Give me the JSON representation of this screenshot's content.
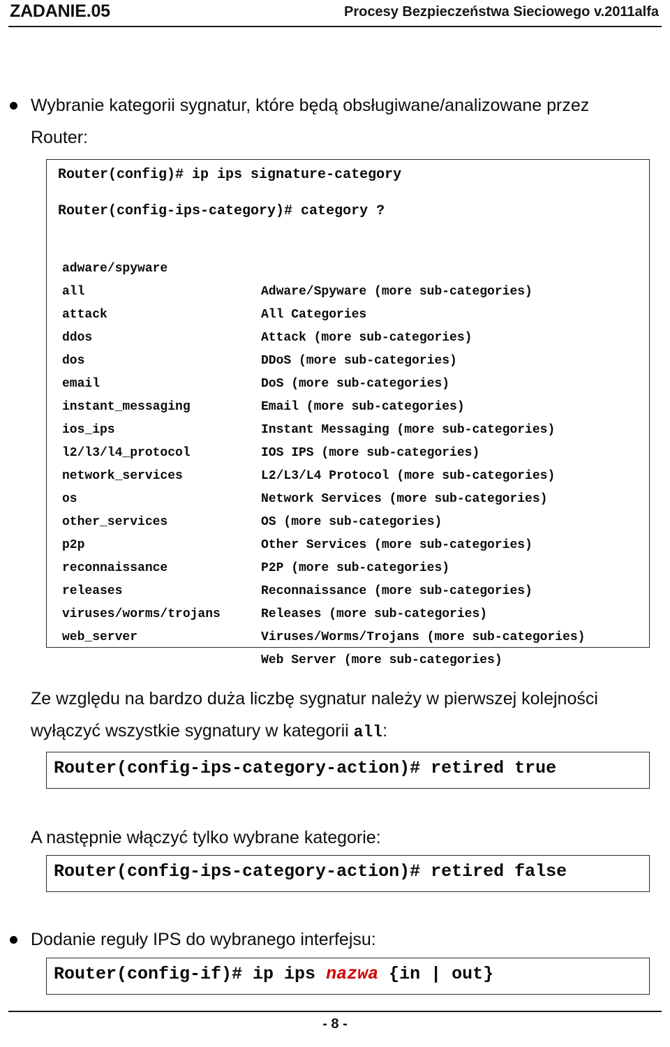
{
  "header": {
    "task_label": "ZADANIE.05",
    "course_title": "Procesy Bezpieczeństwa Sieciowego  v.2011alfa"
  },
  "sections": {
    "bullet1_line1": "Wybranie kategorii sygnatur, które będą obsługiwane/analizowane przez",
    "bullet1_line2": "Router:",
    "code1_line1": "Router(config)# ip ips signature-category",
    "code1_line2": "Router(config-ips-category)# category ?",
    "note1_line1": "Ze względu na bardzo duża liczbę sygnatur należy w pierwszej kolejności",
    "note1_line2_prefix": "wyłączyć wszystkie sygnatury w kategorii ",
    "note1_line2_mono": "all",
    "note1_line2_suffix": ":",
    "code2": "Router(config-ips-category-action)# retired true",
    "note2": "A następnie włączyć tylko wybrane kategorie:",
    "code3": "Router(config-ips-category-action)# retired false",
    "bullet2": "Dodanie reguły IPS do wybranego interfejsu:",
    "code4_prefix": "Router(config-if)# ip ips ",
    "code4_highlight": "nazwa",
    "code4_suffix": " {in | out}"
  },
  "categories": [
    {
      "key": "adware/spyware",
      "value": "Adware/Spyware (more sub-categories)"
    },
    {
      "key": "all",
      "value": "All Categories"
    },
    {
      "key": "attack",
      "value": "Attack (more sub-categories)"
    },
    {
      "key": "ddos",
      "value": "DDoS (more sub-categories)"
    },
    {
      "key": "dos",
      "value": "DoS (more sub-categories)"
    },
    {
      "key": "email",
      "value": "Email (more sub-categories)"
    },
    {
      "key": "instant_messaging",
      "value": "Instant Messaging (more sub-categories)"
    },
    {
      "key": "ios_ips",
      "value": "IOS IPS (more sub-categories)"
    },
    {
      "key": "l2/l3/l4_protocol",
      "value": "L2/L3/L4 Protocol (more sub-categories)"
    },
    {
      "key": "network_services",
      "value": "Network Services (more sub-categories)"
    },
    {
      "key": "os",
      "value": "OS (more sub-categories)"
    },
    {
      "key": "other_services",
      "value": "Other Services (more sub-categories)"
    },
    {
      "key": "p2p",
      "value": "P2P (more sub-categories)"
    },
    {
      "key": "reconnaissance",
      "value": "Reconnaissance (more sub-categories)"
    },
    {
      "key": "releases",
      "value": "Releases (more sub-categories)"
    },
    {
      "key": "viruses/worms/trojans",
      "value": "Viruses/Worms/Trojans (more sub-categories)"
    },
    {
      "key": "web_server",
      "value": "Web Server (more sub-categories)"
    }
  ],
  "footer": {
    "page_number": "- 8 -"
  },
  "colors": {
    "text": "#0d0d0d",
    "highlight": "#cc0000",
    "rule": "#1a1a1a",
    "box_border": "#2b2b2b"
  }
}
